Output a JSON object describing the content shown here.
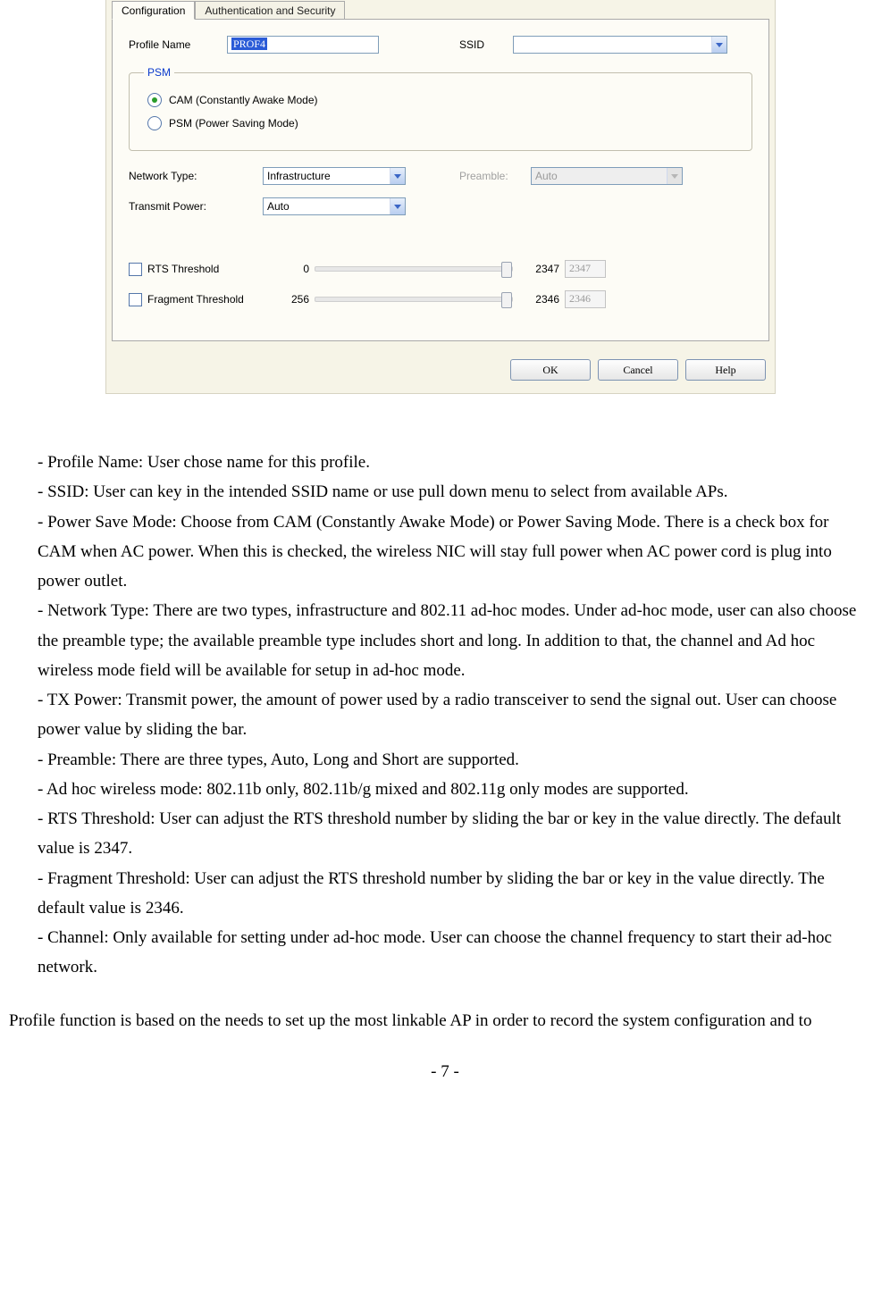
{
  "dialog": {
    "tabs": {
      "config": "Configuration",
      "auth": "Authentication and Security"
    },
    "profile": {
      "label": "Profile Name",
      "value": "PROF4"
    },
    "ssid": {
      "label": "SSID",
      "value": ""
    },
    "psm": {
      "legend": "PSM",
      "cam": "CAM (Constantly Awake Mode)",
      "psm": "PSM (Power Saving Mode)"
    },
    "network_type": {
      "label": "Network Type:",
      "value": "Infrastructure"
    },
    "transmit_power": {
      "label": "Transmit Power:",
      "value": "Auto"
    },
    "preamble": {
      "label": "Preamble:",
      "value": "Auto"
    },
    "rts": {
      "label": "RTS Threshold",
      "min": "0",
      "max": "2347",
      "value": "2347"
    },
    "frag": {
      "label": "Fragment Threshold",
      "min": "256",
      "max": "2346",
      "value": "2346"
    },
    "buttons": {
      "ok": "OK",
      "cancel": "Cancel",
      "help": "Help"
    }
  },
  "doc": {
    "items": [
      "- Profile Name: User chose name for this profile.",
      "- SSID: User can key in the intended SSID name or use pull down menu to select from available APs.",
      "- Power Save Mode: Choose from CAM (Constantly Awake Mode) or Power Saving Mode. There is a check box for CAM when AC power. When this is checked, the wireless NIC will stay full power when AC power cord is plug into power outlet.",
      "- Network Type:  There are two types, infrastructure and 802.11 ad-hoc modes. Under ad-hoc mode, user can also choose the preamble type; the available preamble type includes short and long. In addition to that, the channel and Ad hoc wireless mode field will be available for setup in ad-hoc mode.",
      "- TX Power: Transmit power, the amount of power used by a radio transceiver to send the signal out. User can choose power value by sliding the bar.",
      "- Preamble: There are three types, Auto, Long and Short are supported.",
      "- Ad hoc wireless mode:  802.11b only, 802.11b/g mixed and 802.11g only modes are supported.",
      "- RTS Threshold: User can adjust the RTS threshold number by sliding the bar or key in the value directly. The default value is 2347.",
      "- Fragment Threshold: User can adjust the RTS threshold number by sliding the bar or key in the value directly. The default value is 2346.",
      "- Channel: Only available for setting under ad-hoc mode. User can choose the channel frequency to start their ad-hoc network."
    ],
    "conclusion": "Profile function is based on the needs to set up the most linkable AP in order to record the system configuration and to",
    "page": "- 7 -"
  }
}
